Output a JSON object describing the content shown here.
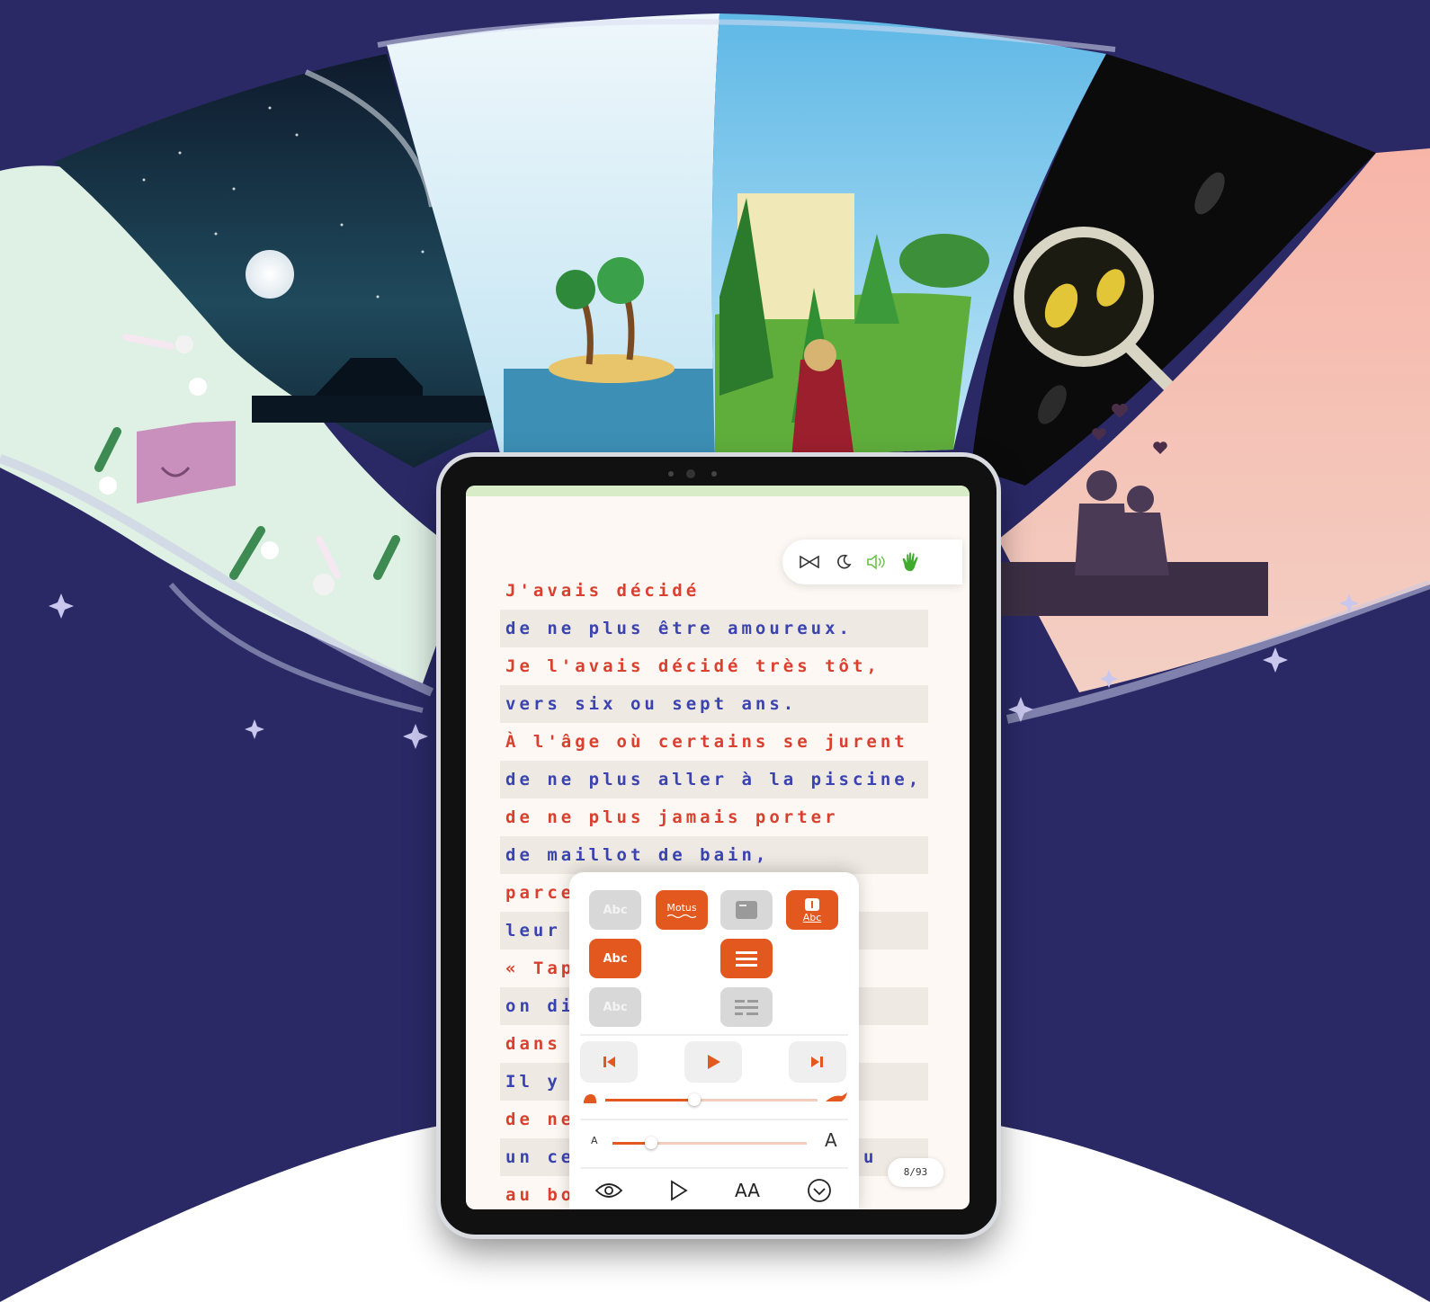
{
  "reader": {
    "lines": [
      "J'avais décidé",
      "de ne plus être amoureux.",
      "Je l'avais décidé très tôt,",
      "vers six ou sept ans.",
      "À l'âge où certains se jurent",
      "de ne plus aller à la piscine,",
      "de ne plus jamais porter",
      "de maillot de bain,",
      "parce",
      "leur a",
      "« Tap",
      "on dir",
      "dans l",
      "Il y a",
      "de ne",
      "un ce",
      "au bo"
    ],
    "line_end_fragments": {
      "leur_a": ":",
      "un_ce": "u"
    },
    "page_indicator": "8/93"
  },
  "toolbar": {
    "icons": [
      "bowtie-icon",
      "moon-icon",
      "speaker-icon",
      "hand-icon"
    ]
  },
  "settings": {
    "style_buttons": [
      "Abc",
      "Motus",
      "Abc",
      "Abc",
      "Abc"
    ],
    "text_size_small": "A",
    "text_size_large": "A",
    "speed_level": 0.42,
    "text_size_level": 0.2,
    "bottom_bar": {
      "text_size_label": "AA"
    }
  },
  "colors": {
    "accent": "#e2581e",
    "text_red": "#d8412f",
    "text_blue": "#3a43b0",
    "background": "#2a2966"
  }
}
